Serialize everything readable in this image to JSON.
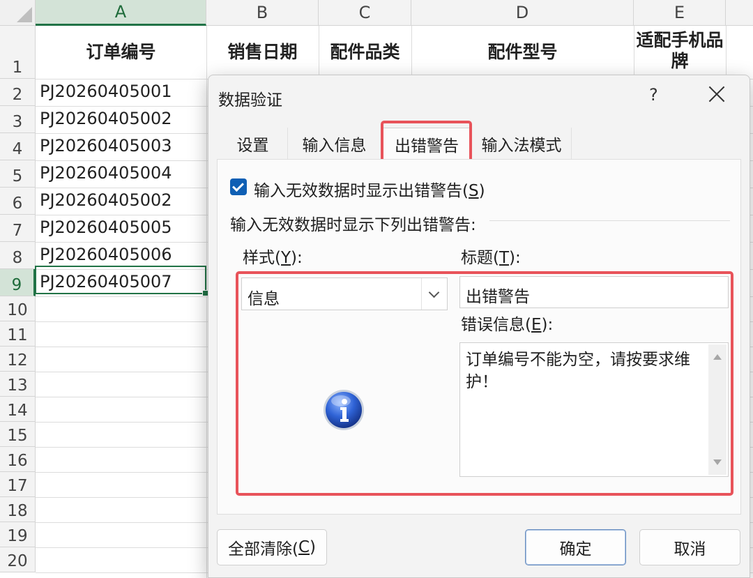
{
  "spreadsheet": {
    "columns": [
      "A",
      "B",
      "C",
      "D",
      "E"
    ],
    "rows": [
      "1",
      "2",
      "3",
      "4",
      "5",
      "6",
      "7",
      "8",
      "9",
      "10",
      "11",
      "12",
      "13",
      "14",
      "15",
      "16",
      "17",
      "18",
      "19",
      "20"
    ],
    "headers": [
      "订单编号",
      "销售日期",
      "配件品类",
      "配件型号",
      "适配手机品牌"
    ],
    "orders": [
      "PJ20260405001",
      "PJ20260405002",
      "PJ20260405003",
      "PJ20260405004",
      "PJ20260405002",
      "PJ20260405005",
      "PJ20260405006",
      "PJ20260405007"
    ],
    "selected_cell": "A9"
  },
  "dialog": {
    "title": "数据验证",
    "help": "?",
    "tabs": [
      "设置",
      "输入信息",
      "出错警告",
      "输入法模式"
    ],
    "active_tab": "出错警告",
    "show_error_checkbox": {
      "label": "输入无效数据时显示出错警告(",
      "key": "S",
      "suffix": ")",
      "checked": true
    },
    "section_label": "输入无效数据时显示下列出错警告:",
    "style_label": {
      "text": "样式(",
      "key": "Y",
      "suffix": "):"
    },
    "style_value": "信息",
    "title_label": {
      "text": "标题(",
      "key": "T",
      "suffix": "):"
    },
    "title_value": "出错警告",
    "message_label": {
      "text": "错误信息(",
      "key": "E",
      "suffix": "):"
    },
    "message_value": "订单编号不能为空，请按要求维护！",
    "icon": "info-icon",
    "buttons": {
      "clear_all": {
        "text": "全部清除(",
        "key": "C",
        "suffix": ")"
      },
      "ok": "确定",
      "cancel": "取消"
    }
  },
  "colors": {
    "highlight": "#e8535a",
    "excel_green": "#217346",
    "checkbox_blue": "#0f5fb4"
  }
}
